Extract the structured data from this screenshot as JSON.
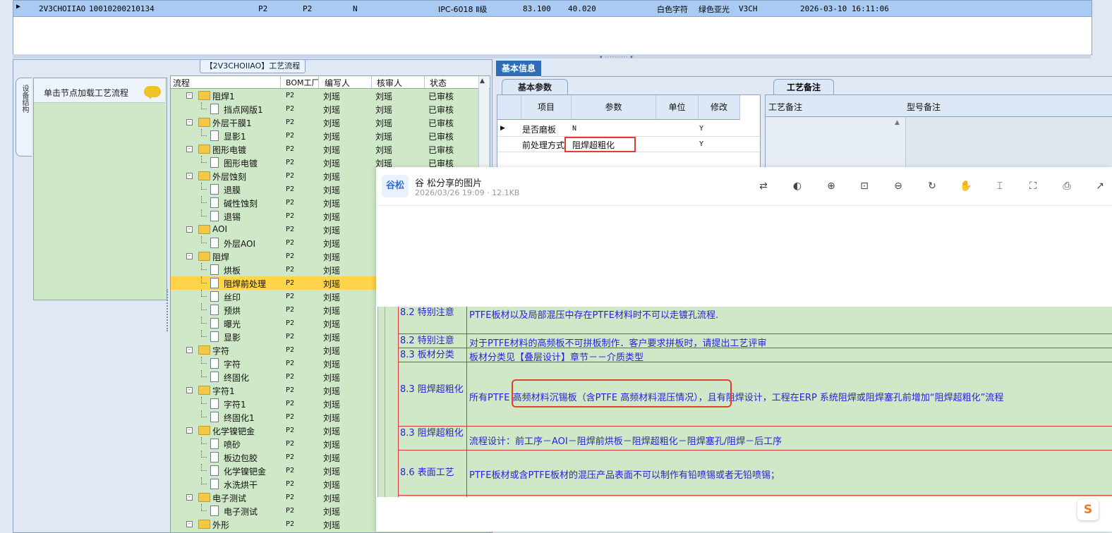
{
  "top_grid": {
    "row": {
      "code": "2V3CHOIIAO",
      "number": "10010200210134",
      "f1": "P2",
      "f2": "P2",
      "f3": "N",
      "grade": "IPC-6018 Ⅱ级",
      "v1": "83.100",
      "v2": "40.020",
      "char_color": "白色字符",
      "mask_color": "绿色亚光",
      "version": "V3CH",
      "time": "2026-03-10 16:11:06"
    }
  },
  "left_panel": {
    "vertical_tab": "设备结构",
    "click_label": "单击节点加载工艺流程",
    "flow_title": "【2V3CHOIIAO】工艺流程"
  },
  "tree": {
    "headers": [
      "流程",
      "BOM工厂",
      "编写人",
      "核审人",
      "状态"
    ],
    "rows": [
      {
        "level": 0,
        "name": "阻焊1",
        "bom": "P2",
        "writer": "刘瑶",
        "reviewer": "刘瑶",
        "status": "已审核"
      },
      {
        "level": 1,
        "name": "挡点网版1",
        "bom": "P2",
        "writer": "刘瑶",
        "reviewer": "刘瑶",
        "status": "已审核"
      },
      {
        "level": 0,
        "name": "外层干膜1",
        "bom": "P2",
        "writer": "刘瑶",
        "reviewer": "刘瑶",
        "status": "已审核"
      },
      {
        "level": 1,
        "name": "显影1",
        "bom": "P2",
        "writer": "刘瑶",
        "reviewer": "刘瑶",
        "status": "已审核"
      },
      {
        "level": 0,
        "name": "图形电镀",
        "bom": "P2",
        "writer": "刘瑶",
        "reviewer": "刘瑶",
        "status": "已审核"
      },
      {
        "level": 1,
        "name": "图形电镀",
        "bom": "P2",
        "writer": "刘瑶",
        "reviewer": "刘瑶",
        "status": "已审核"
      },
      {
        "level": 0,
        "name": "外层蚀刻",
        "bom": "P2",
        "writer": "刘瑶",
        "reviewer": "",
        "status": ""
      },
      {
        "level": 1,
        "name": "退膜",
        "bom": "P2",
        "writer": "刘瑶",
        "reviewer": "",
        "status": ""
      },
      {
        "level": 1,
        "name": "碱性蚀刻",
        "bom": "P2",
        "writer": "刘瑶",
        "reviewer": "",
        "status": ""
      },
      {
        "level": 1,
        "name": "退锡",
        "bom": "P2",
        "writer": "刘瑶",
        "reviewer": "",
        "status": ""
      },
      {
        "level": 0,
        "name": "AOI",
        "bom": "P2",
        "writer": "刘瑶",
        "reviewer": "",
        "status": ""
      },
      {
        "level": 1,
        "name": "外层AOI",
        "bom": "P2",
        "writer": "刘瑶",
        "reviewer": "",
        "status": ""
      },
      {
        "level": 0,
        "name": "阻焊",
        "bom": "P2",
        "writer": "刘瑶",
        "reviewer": "",
        "status": ""
      },
      {
        "level": 1,
        "name": "烘板",
        "bom": "P2",
        "writer": "刘瑶",
        "reviewer": "",
        "status": ""
      },
      {
        "level": 1,
        "name": "阻焊前处理",
        "bom": "P2",
        "writer": "刘瑶",
        "reviewer": "",
        "status": "",
        "selected": true
      },
      {
        "level": 1,
        "name": "丝印",
        "bom": "P2",
        "writer": "刘瑶",
        "reviewer": "",
        "status": ""
      },
      {
        "level": 1,
        "name": "预烘",
        "bom": "P2",
        "writer": "刘瑶",
        "reviewer": "",
        "status": ""
      },
      {
        "level": 1,
        "name": "曝光",
        "bom": "P2",
        "writer": "刘瑶",
        "reviewer": "",
        "status": ""
      },
      {
        "level": 1,
        "name": "显影",
        "bom": "P2",
        "writer": "刘瑶",
        "reviewer": "",
        "status": ""
      },
      {
        "level": 0,
        "name": "字符",
        "bom": "P2",
        "writer": "刘瑶",
        "reviewer": "",
        "status": ""
      },
      {
        "level": 1,
        "name": "字符",
        "bom": "P2",
        "writer": "刘瑶",
        "reviewer": "",
        "status": ""
      },
      {
        "level": 1,
        "name": "终固化",
        "bom": "P2",
        "writer": "刘瑶",
        "reviewer": "",
        "status": ""
      },
      {
        "level": 0,
        "name": "字符1",
        "bom": "P2",
        "writer": "刘瑶",
        "reviewer": "",
        "status": ""
      },
      {
        "level": 1,
        "name": "字符1",
        "bom": "P2",
        "writer": "刘瑶",
        "reviewer": "",
        "status": ""
      },
      {
        "level": 1,
        "name": "终固化1",
        "bom": "P2",
        "writer": "刘瑶",
        "reviewer": "",
        "status": ""
      },
      {
        "level": 0,
        "name": "化学镍钯金",
        "bom": "P2",
        "writer": "刘瑶",
        "reviewer": "",
        "status": ""
      },
      {
        "level": 1,
        "name": "喷砂",
        "bom": "P2",
        "writer": "刘瑶",
        "reviewer": "",
        "status": ""
      },
      {
        "level": 1,
        "name": "板边包胶",
        "bom": "P2",
        "writer": "刘瑶",
        "reviewer": "",
        "status": ""
      },
      {
        "level": 1,
        "name": "化学镍钯金",
        "bom": "P2",
        "writer": "刘瑶",
        "reviewer": "",
        "status": ""
      },
      {
        "level": 1,
        "name": "水洗烘干",
        "bom": "P2",
        "writer": "刘瑶",
        "reviewer": "",
        "status": ""
      },
      {
        "level": 0,
        "name": "电子测试",
        "bom": "P2",
        "writer": "刘瑶",
        "reviewer": "",
        "status": ""
      },
      {
        "level": 1,
        "name": "电子测试",
        "bom": "P2",
        "writer": "刘瑶",
        "reviewer": "",
        "status": ""
      },
      {
        "level": 0,
        "name": "外形",
        "bom": "P2",
        "writer": "刘瑶",
        "reviewer": "",
        "status": ""
      }
    ]
  },
  "basic_info": {
    "tab": "基本信息",
    "params_tab": "基本参数",
    "headers": [
      "项目",
      "参数",
      "单位",
      "修改"
    ],
    "rows": [
      {
        "item": "是否磨板",
        "param": "N",
        "unit": "",
        "modify": "Y"
      },
      {
        "item": "前处理方式",
        "param": "阻焊超粗化",
        "unit": "",
        "modify": "Y"
      }
    ],
    "notes_tab": "工艺备注",
    "note_headers": [
      "工艺备注",
      "型号备注"
    ]
  },
  "viewer": {
    "avatar": "谷松",
    "title": "谷 松分享的图片",
    "meta": "2026/03/26 19:09 · 12.1KB",
    "tools": [
      "translate-icon",
      "contrast-icon",
      "zoom-in-icon",
      "original-size-icon",
      "zoom-out-icon",
      "rotate-icon",
      "hand-icon",
      "text-extract-icon",
      "screenshot-icon",
      "save-icon",
      "share-icon"
    ]
  },
  "doc_rows": [
    {
      "section": "8.2 特别注意",
      "content": "PTFE板材以及局部混压中存在PTFE材料时不可以走镀孔流程."
    },
    {
      "section": "8.2 特别注意",
      "content": "对于PTFE材料的高频板不可拼板制作．客户要求拼板时，请提出工艺评审"
    },
    {
      "section": "8.3 板材分类",
      "content": "板材分类见【叠层设计】章节－－介质类型"
    },
    {
      "section": "8.3 阻焊超粗化",
      "content": "所有PTFE 高频材料沉锡板（含PTFE 高频材料混压情况），且有阻焊设计，工程在ERP 系统阻焊或阻焊塞孔前增加“阻焊超粗化”流程"
    },
    {
      "section": "8.3 阻焊超粗化",
      "content": "流程设计：前工序－AOI－阻焊前烘板－阻焊超粗化－阻焊塞孔/阻焊－后工序"
    },
    {
      "section": "8.6 表面工艺",
      "content": "PTFE板材或含PTFE板材的混压产品表面不可以制作有铅喷锡或者无铅喷锡；"
    }
  ],
  "float_button": "S"
}
